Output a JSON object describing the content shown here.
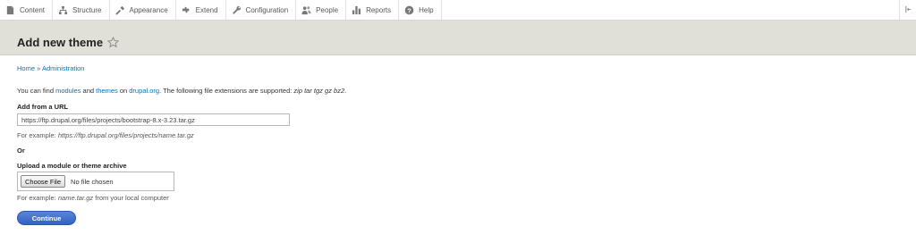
{
  "toolbar": {
    "items": [
      {
        "label": "Content",
        "icon": "content-icon"
      },
      {
        "label": "Structure",
        "icon": "structure-icon"
      },
      {
        "label": "Appearance",
        "icon": "appearance-icon"
      },
      {
        "label": "Extend",
        "icon": "extend-icon"
      },
      {
        "label": "Configuration",
        "icon": "configuration-icon"
      },
      {
        "label": "People",
        "icon": "people-icon"
      },
      {
        "label": "Reports",
        "icon": "reports-icon"
      },
      {
        "label": "Help",
        "icon": "help-icon"
      }
    ]
  },
  "header": {
    "title": "Add new theme"
  },
  "breadcrumb": {
    "home": "Home",
    "separator": " » ",
    "admin": "Administration"
  },
  "intro": {
    "prefix": "You can find ",
    "modules": "modules",
    "and": " and ",
    "themes": "themes",
    "on": " on ",
    "drupal": "drupal.org",
    "suffix": ". The following file extensions are supported: ",
    "extensions": "zip tar tgz gz bz2",
    "end": "."
  },
  "url_section": {
    "label": "Add from a URL",
    "value": "https://ftp.drupal.org/files/projects/bootstrap-8.x-3.23.tar.gz",
    "example_prefix": "For example: ",
    "example": "https://ftp.drupal.org/files/projects/name.tar.gz"
  },
  "or_label": "Or",
  "upload_section": {
    "label": "Upload a module or theme archive",
    "choose_label": "Choose File",
    "no_file": "No file chosen",
    "example_prefix": "For example: ",
    "example": "name.tar.gz",
    "example_suffix": " from your local computer"
  },
  "continue_label": "Continue",
  "colors": {
    "link": "#0074bd",
    "header_bg": "#e0e0d8",
    "button": "#3c6ecb"
  }
}
